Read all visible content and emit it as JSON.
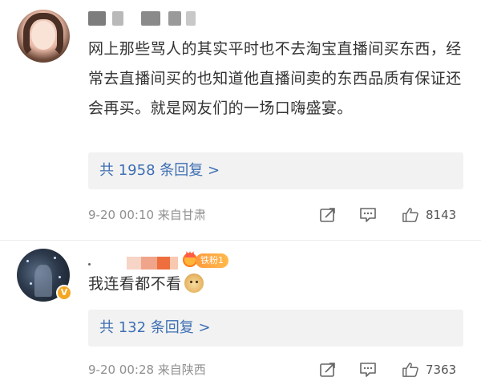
{
  "comments": [
    {
      "text": "网上那些骂人的其实平时也不去淘宝直播间买东西，经常去直播间买的也知道他直播间卖的东西品质有保证还会再买。就是网友们的一场口嗨盛宴。",
      "replies_label": "共 1958 条回复 >",
      "meta": "9-20 00:10  来自甘肃",
      "likes": "8143"
    },
    {
      "badge": "铁粉1",
      "text": "我连看都不看",
      "replies_label": "共 132 条回复 >",
      "meta": "9-20 00:28  来自陕西",
      "likes": "7363"
    }
  ],
  "icons": {
    "share": "share-icon",
    "comment": "comment-icon",
    "like": "thumbs-up-icon",
    "verified": "verified-badge-icon",
    "fan": "fan-crown-icon",
    "emoji": "doge-emoji-icon"
  },
  "colors": {
    "link": "#3e6fb3",
    "meta": "#909090",
    "reply_bg": "#f2f2f2",
    "verified": "#f5a623",
    "fan_badge": "#ff9a3c"
  }
}
